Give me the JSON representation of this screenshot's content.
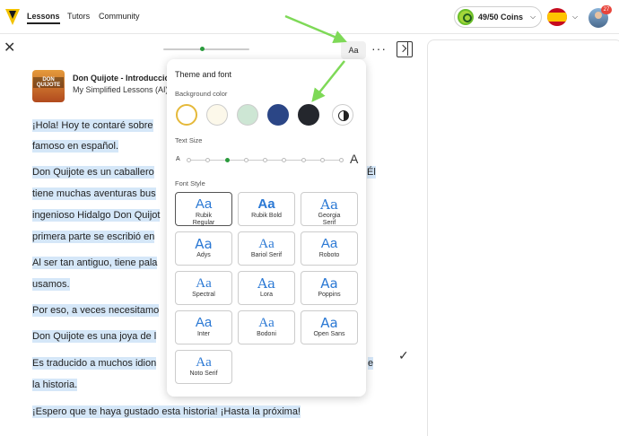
{
  "nav": {
    "links": [
      "Lessons",
      "Tutors",
      "Community"
    ],
    "coins_label": "49/50 Coins",
    "notification_count": "27"
  },
  "toolbar": {
    "font_button_label": "Aa",
    "more_label": "···",
    "reading_progress": 0.45
  },
  "lesson": {
    "cover_text": "DON QUIJOTE",
    "title": "Don Quijote - Introducción",
    "subtitle": "My Simplified Lessons (AI)"
  },
  "paragraphs": [
    [
      "¡Hola!  Hoy te contaré sobre",
      "famoso en español."
    ],
    [
      "Don Quijote es un caballero",
      "tiene muchas aventuras bus",
      "ingenioso Hidalgo Don Quijot",
      "primera parte se escribió en"
    ],
    [
      "Al ser tan antiguo, tiene pala",
      "usamos."
    ],
    [
      "Por eso, a veces necesitamo"
    ],
    [
      "Don Quijote es una joya de l"
    ],
    [
      "Es traducido a muchos idion",
      "la historia."
    ],
    [
      "¡Espero que te haya gustado esta historia!  ¡Hasta la próxima!"
    ]
  ],
  "right_edge_fragments": {
    "p2_line1": "Él",
    "p6_line1": "e"
  },
  "popup": {
    "title": "Theme and font",
    "background_label": "Background color",
    "background_colors": [
      "#ffffff",
      "#fcf8ea",
      "#cde6d4",
      "#2b4686",
      "#24272d"
    ],
    "background_selected": 0,
    "text_size_label": "Text Size",
    "text_size_small": "A",
    "text_size_big": "A",
    "text_size_level": 2,
    "text_size_steps": 9,
    "font_style_label": "Font Style",
    "font_sample": "Aa",
    "fonts": [
      "Rubik Regular",
      "Rubik Bold",
      "Georgia Serif",
      "Adys",
      "Bariol Serif",
      "Roboto",
      "Spectral",
      "Lora",
      "Poppins",
      "Inter",
      "Bodoni",
      "Open Sans",
      "Noto Serif"
    ],
    "font_selected": 0
  },
  "colors": {
    "highlight": "#d5e7f8",
    "accent_green": "#2a9b3c",
    "font_sample_blue": "#2a78d4",
    "annotation_arrow": "#7ed957"
  }
}
